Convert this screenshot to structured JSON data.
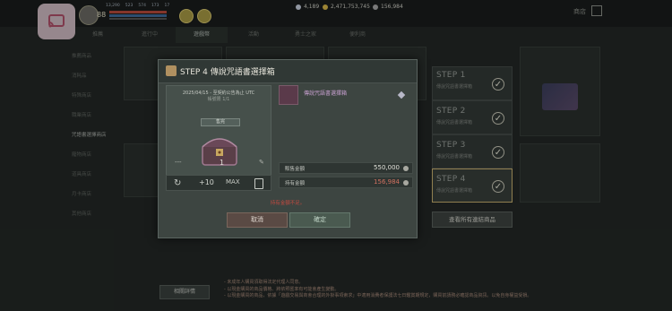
{
  "topbar": {
    "level": "88",
    "stats": [
      "13,290",
      "523",
      "574",
      "173",
      "17"
    ],
    "currencies": [
      {
        "icon": "diamond-icon",
        "value": "4,189",
        "color": "#c8d0e0"
      },
      {
        "icon": "gold-coin-icon",
        "value": "2,471,753,745",
        "color": "#d8b848"
      },
      {
        "icon": "silver-coin-icon",
        "value": "156,984",
        "color": "#a8a8a8"
      }
    ],
    "shop_label": "商店"
  },
  "tabs": [
    "推薦",
    "進行中",
    "遊戲幣",
    "活動",
    "勇士之家",
    "便利商"
  ],
  "sidebar": {
    "items": [
      "推薦商品",
      "消耗品",
      "特殊商店",
      "職業商店",
      "咒語書選擇商店",
      "寵物商店",
      "道具商店",
      "月卡商店",
      "其他商店"
    ]
  },
  "steps": [
    {
      "title": "STEP 1",
      "sub": "傳說咒語書選擇箱"
    },
    {
      "title": "STEP 2",
      "sub": "傳說咒語書選擇箱"
    },
    {
      "title": "STEP 3",
      "sub": "傳說咒語書選擇箱"
    },
    {
      "title": "STEP 4",
      "sub": "傳說咒語書選擇箱"
    }
  ],
  "view_all_label": "查看所有連結商品",
  "detail_button": "相關詳情",
  "notes": [
    "- 未成年人購買須取得法定代理人同意。",
    "- 以現金購買的商品價格、將依照匯率有可能會產生變動。",
    "- 以現金購買的商品，依據「遊戲交易與商會合理的外掛事項索求」中適用消費者保護法七日鑑賞期規定，購買前請務必確認商品資訊。以免自身權益受損。"
  ],
  "modal": {
    "title": "STEP 4  傳說咒語書選擇箱",
    "date_text": "2025/04/15 - 至契約公告為止 UTC",
    "limit_text": "帳號限 1/1",
    "sold_badge": "售完",
    "item_name": "傳說咒語書選擇箱",
    "quantity": "1",
    "qty_minus": "---",
    "plus10": "+10",
    "max_label": "MAX",
    "price_label": "販售金額",
    "price_value": "550,000",
    "owned_label": "持有金額",
    "owned_value": "156,984",
    "warn_text": "持有金額不足。",
    "cancel_label": "取消",
    "confirm_label": "確定"
  }
}
